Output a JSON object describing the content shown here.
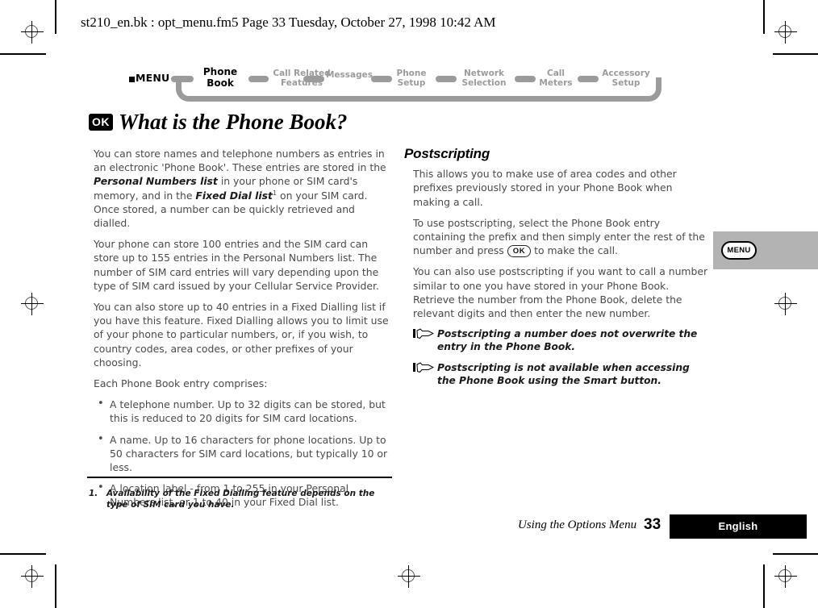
{
  "running_header": "st210_en.bk : opt_menu.fm5  Page 33  Tuesday, October 27, 1998  10:42 AM",
  "navbar": {
    "menu_label": "MENU",
    "items": [
      {
        "line1": "Phone",
        "line2": "Book",
        "current": true
      },
      {
        "line1": "Call Related",
        "line2": "Features",
        "current": false
      },
      {
        "line1": "Messages",
        "line2": "",
        "current": false
      },
      {
        "line1": "Phone",
        "line2": "Setup",
        "current": false
      },
      {
        "line1": "Network",
        "line2": "Selection",
        "current": false
      },
      {
        "line1": "Call",
        "line2": "Meters",
        "current": false
      },
      {
        "line1": "Accessory",
        "line2": "Setup",
        "current": false
      }
    ]
  },
  "title": {
    "key_icon_label": "OK",
    "heading": "What is the Phone Book?"
  },
  "left_column": {
    "para1_a": "You can store names and telephone numbers as entries in an electronic 'Phone Book'. These entries are stored in the ",
    "para1_em1": "Personal Numbers list",
    "para1_b": " in your phone or SIM card's memory, and in the ",
    "para1_em2": "Fixed Dial list",
    "para1_sup": "1",
    "para1_c": " on your SIM card. Once stored, a number can be quickly retrieved and dialled.",
    "para2": "Your phone can store 100 entries and the SIM card can store up to 155 entries in the Personal Numbers list. The number of SIM card entries will vary depending upon the type of SIM card issued by your Cellular Service Provider.",
    "para3": "You can also store up to 40 entries in a Fixed Dialling list if you have this feature. Fixed Dialling allows you to limit use of your phone to particular numbers, or, if you wish, to country codes, area codes, or other prefixes of your choosing.",
    "para4": "Each Phone Book entry comprises:",
    "bullets": [
      "A telephone number. Up to 32 digits can be stored, but this is reduced to 20 digits for SIM card locations.",
      "A name. Up to 16 characters for phone locations. Up to 50 characters for SIM card locations, but typically 10 or less.",
      "A location label - from 1 to 255 in your Personal Numbers list, or 1 to 40 in your Fixed Dial list."
    ]
  },
  "right_column": {
    "heading": "Postscripting",
    "para1": "This allows you to make use of area codes and other prefixes previously stored in your Phone Book when making a call.",
    "para2_a": "To use postscripting, select the Phone Book entry containing the prefix and then simply enter the rest of the number and press ",
    "para2_key": "OK",
    "para2_b": " to make the call.",
    "para3": "You can also use postscripting if you want to call a number similar to one you have stored in your Phone Book. Retrieve the number from the Phone Book, delete the relevant digits and then enter the new number.",
    "notes": [
      "Postscripting a number does not overwrite the entry in the Phone Book.",
      "Postscripting is not available when accessing the Phone Book using the Smart button."
    ]
  },
  "key_callout": {
    "key_label": "MENU"
  },
  "footnote": {
    "number": "1.",
    "text": "Availability of the Fixed Dialling feature depends on the type of SIM card you have."
  },
  "footer": {
    "section": "Using the Options Menu",
    "page_number": "33",
    "language": "English"
  },
  "colors": {
    "nav_gray": "#9b9b9b",
    "body_text": "#4a4a4a",
    "callout_gray": "#b3b3b3",
    "black": "#000000"
  }
}
